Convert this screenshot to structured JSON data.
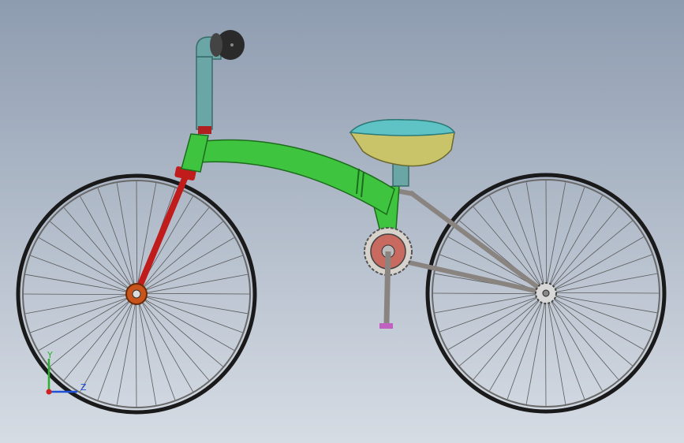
{
  "viewport": {
    "background_top": "#8e9cb0",
    "background_bottom": "#d6dce4"
  },
  "triad": {
    "y_label": "Y",
    "z_label": "Z",
    "y_color": "#2db02d",
    "z_color": "#2050d8",
    "x_color": "#d02020"
  },
  "model": {
    "frame_color": "#3fc43f",
    "fork_color": "#c01c1c",
    "stem_color": "#6aa6a6",
    "saddle_top_color": "#5fc3c6",
    "saddle_body_color": "#c9c46a",
    "stay_color": "#8a8480",
    "tire_color": "#1a1a1a",
    "spoke_color": "#5a5a5a",
    "hub_color": "#c8541c",
    "chainring_color": "#c86a60",
    "pedal_color": "#c060c0",
    "knob_color": "#2a2a2a"
  }
}
